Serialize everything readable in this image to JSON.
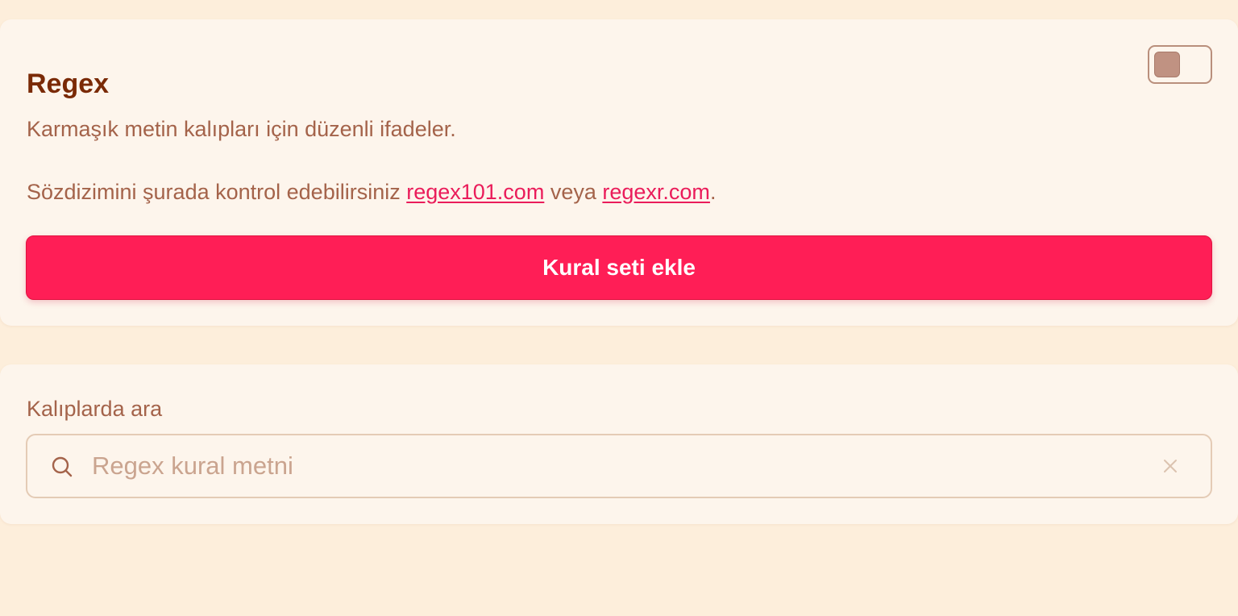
{
  "regex_card": {
    "title": "Regex",
    "toggle": {
      "enabled": false
    },
    "description": "Karmaşık metin kalıpları için düzenli ifadeler.",
    "syntax_prefix": "Sözdizimini şurada kontrol edebilirsiniz ",
    "link1": "regex101.com",
    "syntax_middle": " veya ",
    "link2": "regexr.com",
    "syntax_suffix": ".",
    "add_button": "Kural seti ekle"
  },
  "search_card": {
    "label": "Kalıplarda ara",
    "value": "",
    "placeholder": "Regex kural metni",
    "search_icon": "search-icon",
    "clear_icon": "close-icon"
  },
  "colors": {
    "background": "#fdeedb",
    "card": "#fdf5ec",
    "title": "#7a2a06",
    "text": "#a4634a",
    "accent": "#ff1e56",
    "link": "#ea1c5a"
  }
}
